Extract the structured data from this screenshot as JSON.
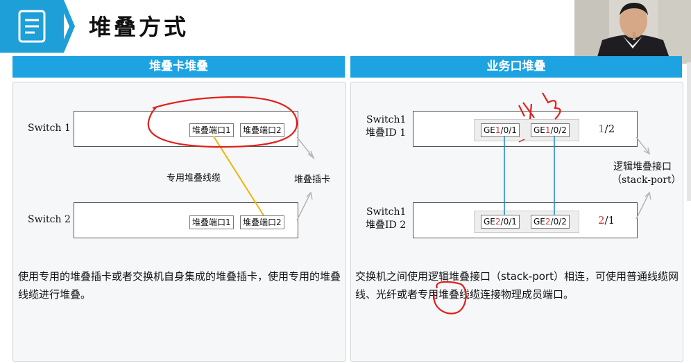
{
  "header": {
    "title": "堆叠方式",
    "icon": "document-list-icon",
    "accent": "#1e9fd8"
  },
  "left_panel": {
    "heading": "堆叠卡堆叠",
    "switch1_label": "Switch 1",
    "switch2_label": "Switch 2",
    "port1": "堆叠端口1",
    "port2": "堆叠端口2",
    "cable_label": "专用堆叠线缆",
    "card_label": "堆叠插卡",
    "description": "使用专用的堆叠插卡或者交换机自身集成的堆叠插卡，使用专用的堆叠线缆进行堆叠。"
  },
  "right_panel": {
    "heading": "业务口堆叠",
    "switch1_name": "Switch1",
    "switch1_id": "堆叠ID 1",
    "switch2_name": "Switch1",
    "switch2_id": "堆叠ID 2",
    "s1_ports": [
      {
        "pre": "GE",
        "num": "1",
        "post": "/0/1"
      },
      {
        "pre": "GE",
        "num": "1",
        "post": "/0/2"
      }
    ],
    "s2_ports": [
      {
        "pre": "GE",
        "num": "2",
        "post": "/0/1"
      },
      {
        "pre": "GE",
        "num": "2",
        "post": "/0/2"
      }
    ],
    "s1_logical": {
      "num": "1",
      "rest": "/2"
    },
    "s2_logical": {
      "num": "2",
      "rest": "/1"
    },
    "logic_label_1": "逻辑堆叠接口",
    "logic_label_2": "（stack-port）",
    "description": "交换机之间使用逻辑堆叠接口（stack-port）相连，可使用普通线缆网线、光纤或者专用堆叠线缆连接物理成员端口。"
  },
  "colors": {
    "panel_header": "#1da3e1",
    "cable": "#f0b400",
    "link": "#2a8fc9",
    "annotation": "#e0201b",
    "port_number": "#d03a3a"
  }
}
